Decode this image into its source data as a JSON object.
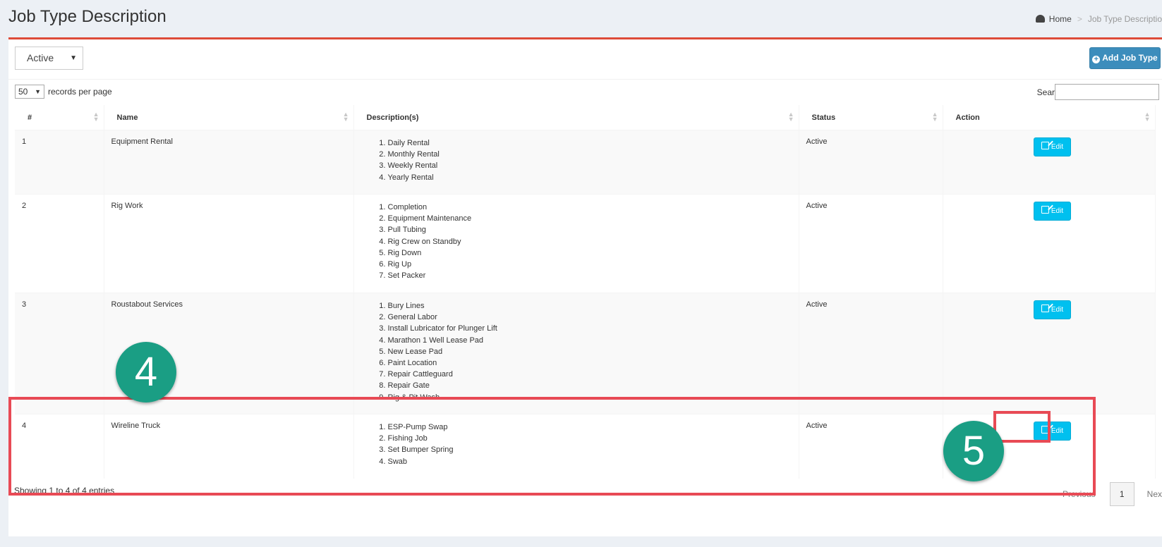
{
  "header": {
    "title": "Job Type Description"
  },
  "breadcrumb": {
    "home": "Home",
    "separator": ">",
    "current": "Job Type Descriptio"
  },
  "toolbar": {
    "status_filter": "Active",
    "add_button": "Add Job Type"
  },
  "table_controls": {
    "page_length": "50",
    "page_length_label": "records per page",
    "search_label": "Search:",
    "search_value": ""
  },
  "table": {
    "columns": [
      "#",
      "Name",
      "Description(s)",
      "Status",
      "Action"
    ],
    "rows": [
      {
        "num": "1",
        "name": "Equipment Rental",
        "descriptions": [
          "Daily Rental",
          "Monthly Rental",
          "Weekly Rental",
          "Yearly Rental"
        ],
        "status": "Active",
        "action": "Edit"
      },
      {
        "num": "2",
        "name": "Rig Work",
        "descriptions": [
          "Completion",
          "Equipment Maintenance",
          "Pull Tubing",
          "Rig Crew on Standby",
          "Rig Down",
          "Rig Up",
          "Set Packer"
        ],
        "status": "Active",
        "action": "Edit"
      },
      {
        "num": "3",
        "name": "Roustabout Services",
        "descriptions": [
          "Bury Lines",
          "General Labor",
          "Install Lubricator for Plunger Lift",
          "Marathon 1 Well Lease Pad",
          "New Lease Pad",
          "Paint Location",
          "Repair Cattleguard",
          "Repair Gate",
          "Rig & Pit Wash"
        ],
        "status": "Active",
        "action": "Edit"
      },
      {
        "num": "4",
        "name": "Wireline Truck",
        "descriptions": [
          "ESP-Pump Swap",
          "Fishing Job",
          "Set Bumper Spring",
          "Swab"
        ],
        "status": "Active",
        "action": "Edit"
      }
    ]
  },
  "footer": {
    "info": "Showing 1 to 4 of 4 entries",
    "previous": "Previous",
    "page": "1",
    "next": "Nex"
  },
  "annotations": {
    "badge_a": "4",
    "badge_b": "5"
  },
  "colors": {
    "accent": "#dd4b39",
    "primary_button": "#3c8dbc",
    "edit_button": "#00c0ef",
    "highlight": "#e84a55",
    "badge": "#1a9e84"
  }
}
